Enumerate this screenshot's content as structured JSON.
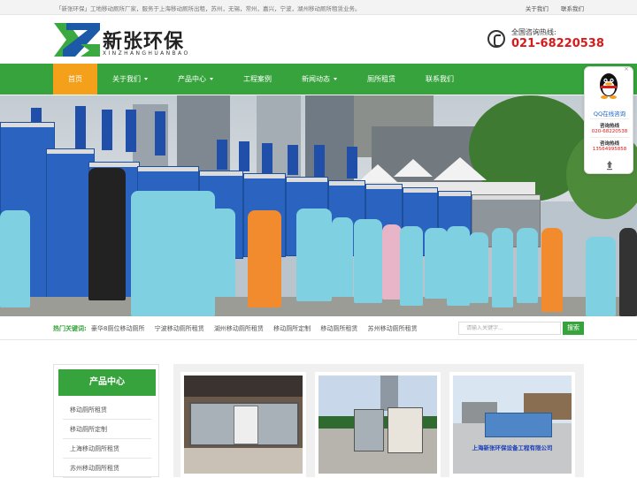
{
  "topbar": {
    "intro": "「新张环保」工地移动厕所厂家，服务于上海移动厕所出租，苏州，无锡，常州，嘉兴，宁波，湖州移动厕所租赁业务。",
    "links": [
      "关于我们",
      "联系我们"
    ]
  },
  "header": {
    "logo_cn": "新张环保",
    "logo_en": "XINZHANGHUANBAO",
    "hotline_label": "全国咨询热线:",
    "hotline_number": "021-68220538"
  },
  "nav": {
    "items": [
      {
        "label": "首页",
        "active": true,
        "dropdown": false
      },
      {
        "label": "关于我们",
        "active": false,
        "dropdown": true
      },
      {
        "label": "产品中心",
        "active": false,
        "dropdown": true
      },
      {
        "label": "工程案例",
        "active": false,
        "dropdown": false
      },
      {
        "label": "新闻动态",
        "active": false,
        "dropdown": true
      },
      {
        "label": "厕所租赁",
        "active": false,
        "dropdown": false
      },
      {
        "label": "联系我们",
        "active": false,
        "dropdown": false
      }
    ]
  },
  "keywords": {
    "title": "热门关键词:",
    "items": [
      "豪华8厕位移动厕所",
      "宁波移动厕所租赁",
      "湖州移动厕所租赁",
      "移动厕所定制",
      "移动厕所租赁",
      "苏州移动厕所租赁"
    ]
  },
  "search": {
    "placeholder": "请输入关键字...",
    "button": "搜索"
  },
  "sidebar": {
    "title": "产品中心",
    "items": [
      "移动厕所租赁",
      "移动厕所定制",
      "上海移动厕所租赁",
      "苏州移动厕所租赁"
    ]
  },
  "products": {
    "caption3": "上海新张环保设备工程有限公司"
  },
  "float_widget": {
    "close": "×",
    "qq_label": "QQ在线咨询",
    "hotline_title": "咨询热线",
    "hotline_number": "020-68220538",
    "hotline2_title": "咨询热线",
    "hotline2_number": "13564995858"
  },
  "colors": {
    "brand_green": "#36a33c",
    "active_orange": "#f5a01b",
    "hotline_red": "#d71a1a"
  }
}
